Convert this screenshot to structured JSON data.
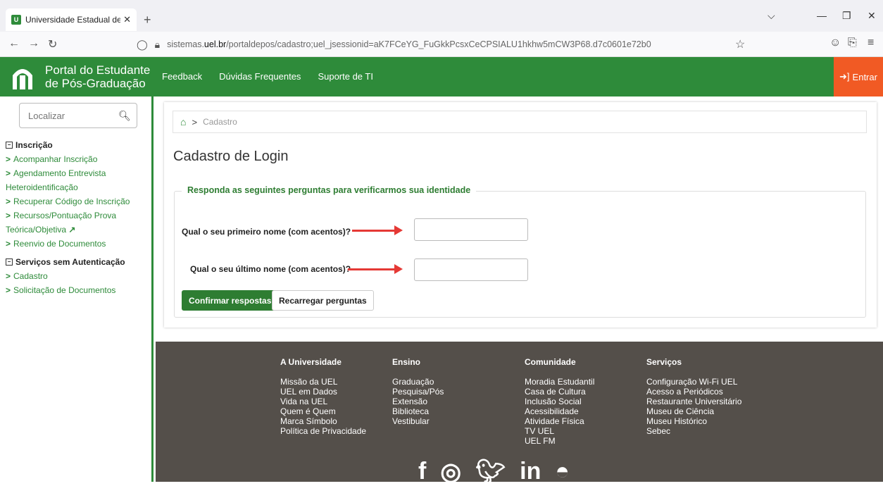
{
  "browser": {
    "tab_title": "Universidade Estadual de Londr",
    "tab_close": "✕",
    "favicon_text": "U",
    "url_prefix": "sistemas.",
    "url_host": "uel.br",
    "url_suffix": "/portaldepos/cadastro;uel_jsessionid=aK7FCeYG_FuGkkPcsxCeCPSIALU1hkhw5mCW3P68.d7c0601e72b0"
  },
  "header": {
    "brand_line1": "Portal do Estudante",
    "brand_line2": "de Pós-Graduação",
    "nav": [
      "Feedback",
      "Dúvidas Frequentes",
      "Suporte de TI"
    ],
    "login_label": "Entrar",
    "brand_color": "#2e8b3a",
    "login_color": "#f15a24"
  },
  "sidebar": {
    "search_placeholder": "Localizar",
    "sections": [
      {
        "title": "Inscrição",
        "links": [
          "Acompanhar Inscrição",
          "Agendamento Entrevista",
          "Heteroidentificação",
          "Recuperar Código de Inscrição",
          "Recursos/Pontuação Prova",
          "Teórica/Objetiva",
          "Reenvio de Documentos"
        ]
      },
      {
        "title": "Serviços sem Autenticação",
        "links": [
          "Cadastro",
          "Solicitação de Documentos"
        ]
      }
    ]
  },
  "main": {
    "breadcrumb_current": "Cadastro",
    "page_title": "Cadastro de Login",
    "fieldset_legend": "Responda as seguintes perguntas para verificarmos sua identidade",
    "question1": "Qual o seu primeiro nome (com acentos)?",
    "question2": "Qual o seu último nome (com acentos)?",
    "answer1": "",
    "answer2": "",
    "confirm_button": "Confirmar respostas",
    "reload_button": "Recarregar perguntas"
  },
  "footer": {
    "columns": [
      {
        "title": "A Universidade",
        "items": [
          "Missão da UEL",
          "UEL em Dados",
          "Vida na UEL",
          "Quem é Quem",
          "Marca Símbolo",
          "Política de Privacidade"
        ]
      },
      {
        "title": "Ensino",
        "items": [
          "Graduação",
          "Pesquisa/Pós",
          "Extensão",
          "Biblioteca",
          "Vestibular"
        ]
      },
      {
        "title": "Comunidade",
        "items": [
          "Moradia Estudantil",
          "Casa de Cultura",
          "Inclusão Social",
          "Acessibilidade",
          "Atividade Física",
          "TV UEL",
          "UEL FM"
        ]
      },
      {
        "title": "Serviços",
        "items": [
          "Configuração Wi-Fi UEL",
          "Acesso a Periódicos",
          "Restaurante Universitário",
          "Museu de Ciência",
          "Museu Histórico",
          "Sebec"
        ]
      }
    ],
    "social_icons": [
      "facebook-icon",
      "instagram-icon",
      "twitter-icon",
      "linkedin-icon",
      "android-icon",
      "apple-icon"
    ]
  }
}
